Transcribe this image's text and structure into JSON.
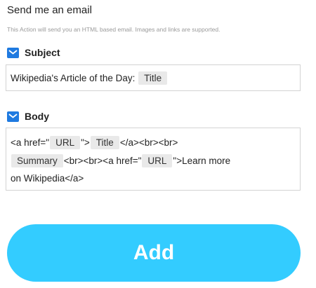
{
  "header": {
    "title": "Send me an email",
    "subtitle": "This Action will send you an HTML based email. Images and links are supported."
  },
  "subject": {
    "label": "Subject",
    "icon": "mail-icon",
    "text": "Wikipedia's Article of the Day:",
    "ingredient": "Title"
  },
  "body": {
    "label": "Body",
    "icon": "mail-icon",
    "parts": [
      "<a href=\"",
      "URL",
      "\">",
      "Title",
      "</a><br><br>",
      "Summary",
      "<br><br><a href=\"",
      "URL",
      "\">Learn more",
      "on Wikipedia</a>"
    ]
  },
  "add_button": {
    "label": "Add"
  },
  "colors": {
    "accent": "#33ccff",
    "icon": "#1f7ae0",
    "pill": "#e9e9e9"
  }
}
